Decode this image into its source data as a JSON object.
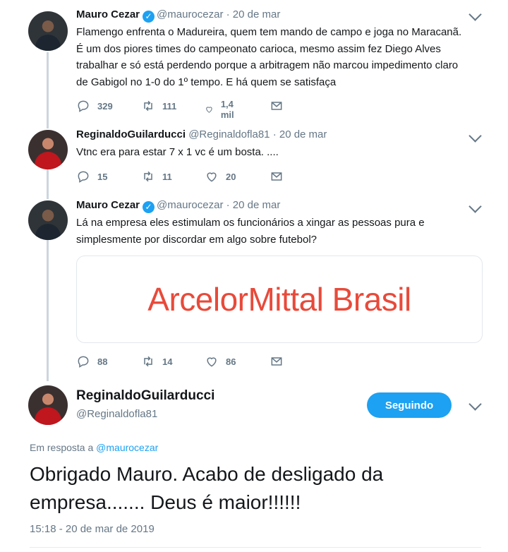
{
  "tweets": [
    {
      "name": "Mauro Cezar",
      "handle": "@maurocezar",
      "date": "· 20 de mar",
      "verified": true,
      "text": "Flamengo enfrenta o Madureira, quem tem mando de campo e joga no Maracanã. É um dos piores times do campeonato carioca, mesmo assim fez Diego Alves trabalhar e só está perdendo porque a arbitragem não marcou impedimento claro de Gabigol no 1-0 do 1º tempo. E há quem se satisfaça",
      "replies": "329",
      "retweets": "111",
      "likes": "1,4 mil"
    },
    {
      "name": "ReginaldoGuilarducci",
      "handle": "@Reginaldofla81",
      "date": "· 20 de mar",
      "verified": false,
      "text": "Vtnc era para estar 7 x 1 vc é um bosta. ....",
      "replies": "15",
      "retweets": "11",
      "likes": "20"
    },
    {
      "name": "Mauro Cezar",
      "handle": "@maurocezar",
      "date": "· 20 de mar",
      "verified": true,
      "text": "Lá na empresa eles estimulam os funcionários a xingar as pessoas pura e simplesmente por discordar em algo sobre futebol?",
      "card_title": "ArcelorMittal Brasil",
      "replies": "88",
      "retweets": "14",
      "likes": "86"
    }
  ],
  "main_tweet": {
    "name": "ReginaldoGuilarducci",
    "handle": "@Reginaldofla81",
    "follow_label": "Seguindo",
    "reply_prefix": "Em resposta a",
    "reply_to": "@maurocezar",
    "text": "Obrigado Mauro. Acabo de desligado da empresa....... Deus é maior!!!!!!",
    "timestamp": "15:18 - 20 de mar de 2019"
  },
  "colors": {
    "accent": "#1da1f2",
    "secondary_text": "#657786",
    "card_brand": "#e84a3a"
  },
  "icons": [
    "verified-badge-icon",
    "chevron-down-icon",
    "reply-icon",
    "retweet-icon",
    "like-icon",
    "direct-message-icon"
  ]
}
